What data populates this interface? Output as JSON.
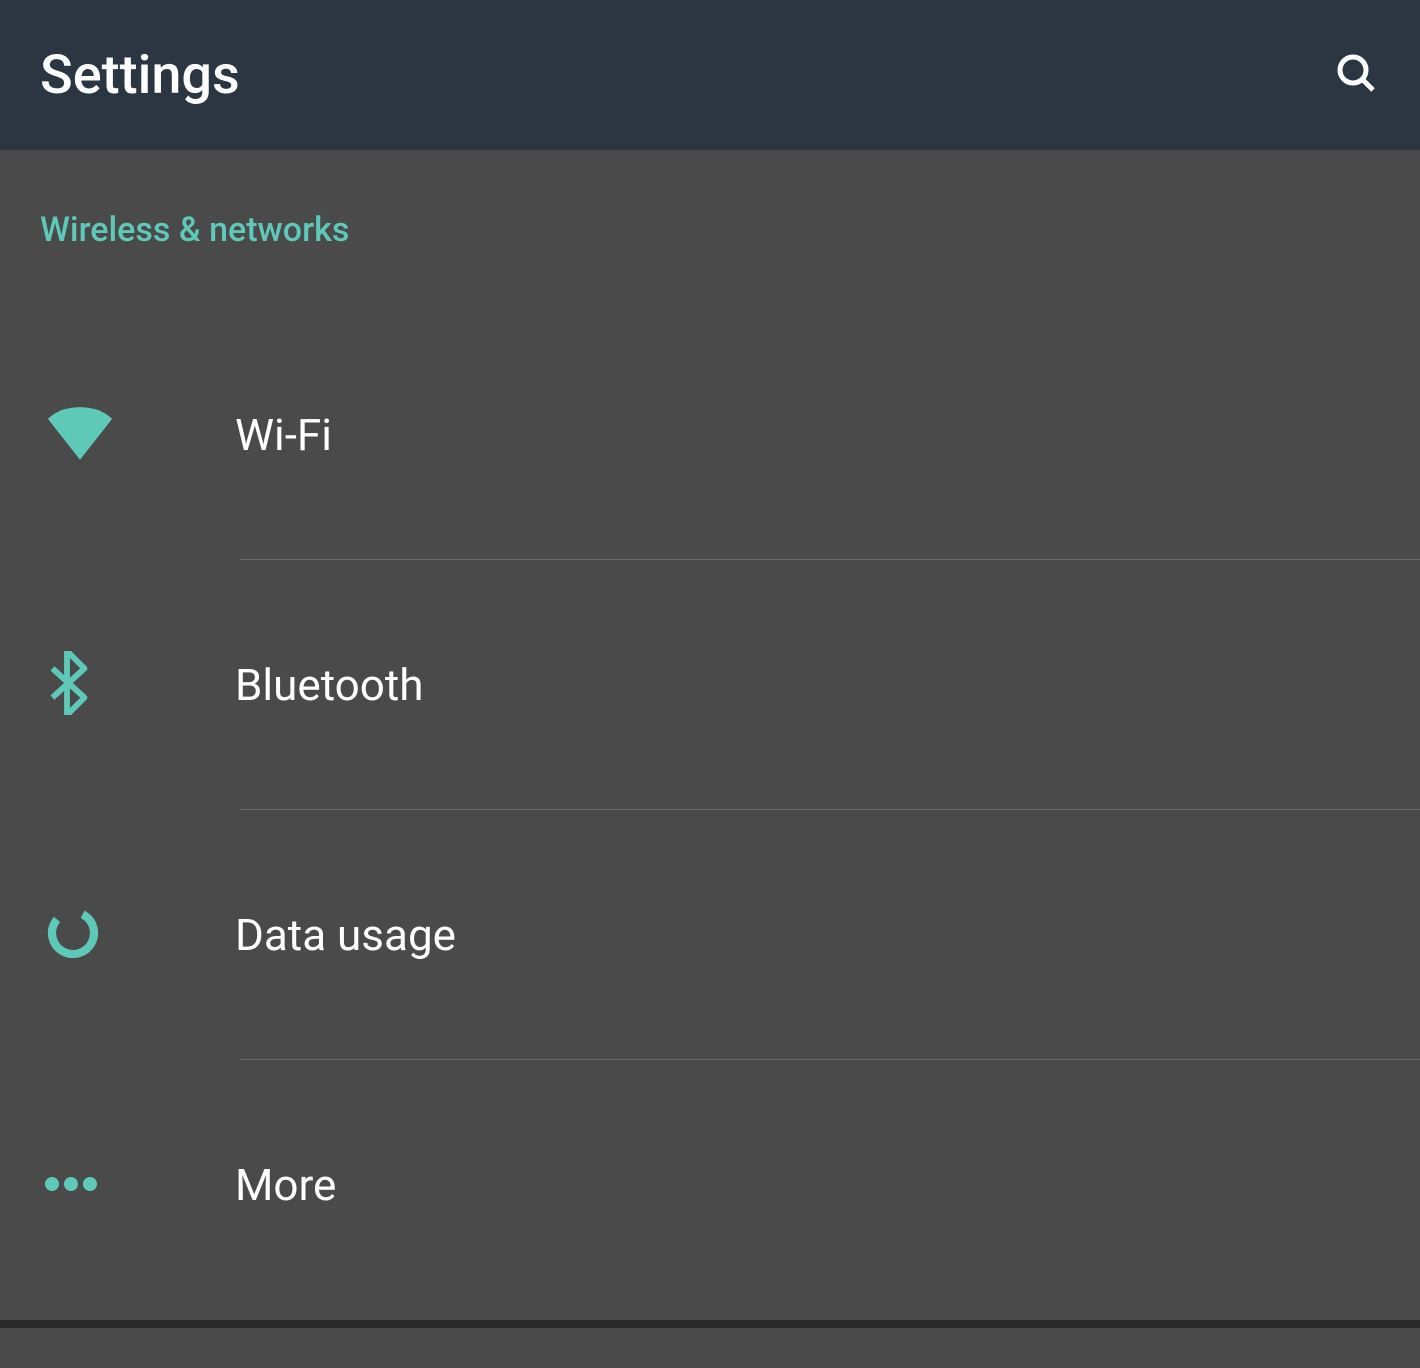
{
  "header": {
    "title": "Settings"
  },
  "section": {
    "header": "Wireless & networks",
    "items": [
      {
        "icon": "wifi-icon",
        "label": "Wi-Fi"
      },
      {
        "icon": "bluetooth-icon",
        "label": "Bluetooth"
      },
      {
        "icon": "data-usage-icon",
        "label": "Data usage"
      },
      {
        "icon": "more-icon",
        "label": "More"
      }
    ]
  },
  "colors": {
    "accent": "#5fc9b9",
    "header_bg": "#2b3642",
    "content_bg": "#4a4a4a"
  }
}
